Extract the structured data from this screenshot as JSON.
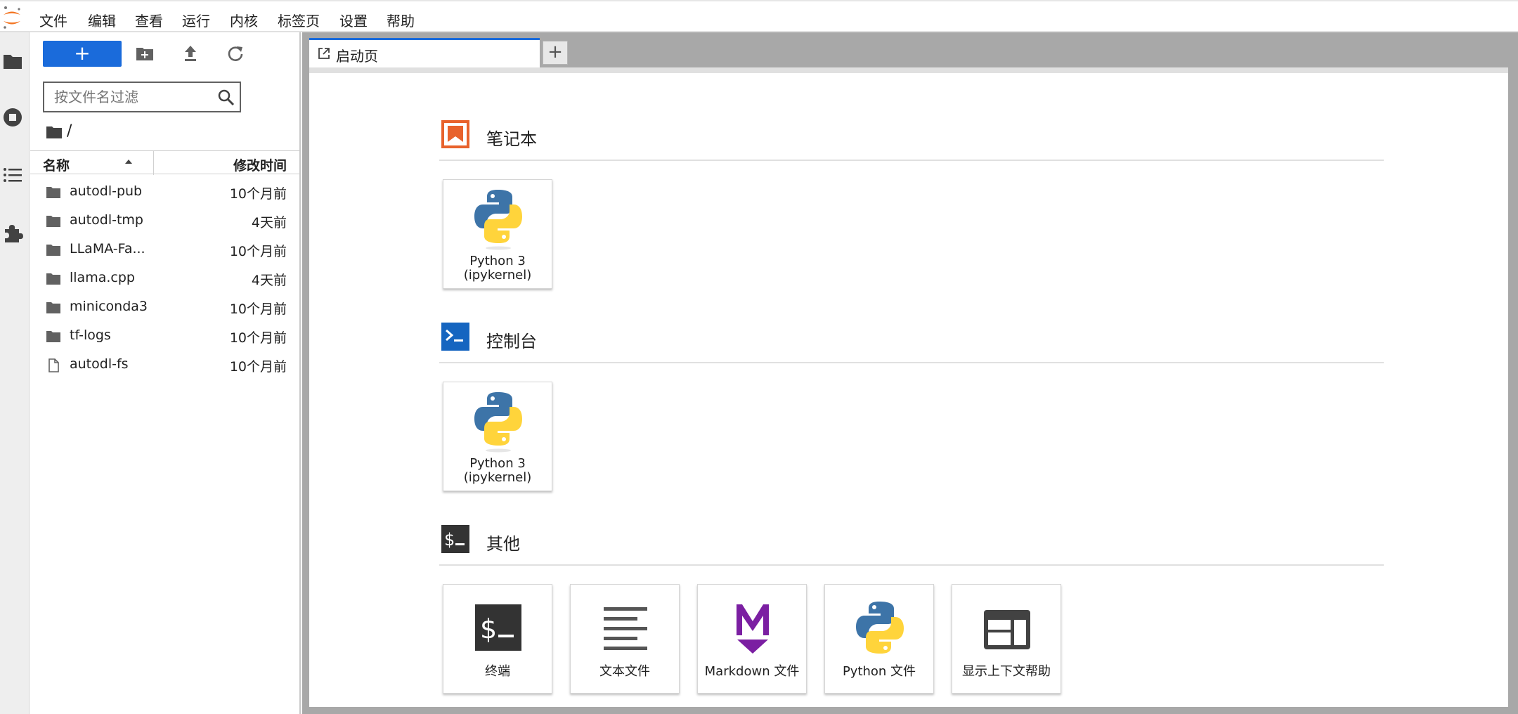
{
  "menu": {
    "items": [
      "文件",
      "编辑",
      "查看",
      "运行",
      "内核",
      "标签页",
      "设置",
      "帮助"
    ]
  },
  "filebrowser": {
    "new_button": "+",
    "filter_placeholder": "按文件名过滤",
    "breadcrumb": "/",
    "columns": {
      "name": "名称",
      "modified": "修改时间"
    },
    "files": [
      {
        "name": "autodl-pub",
        "modified": "10个月前",
        "type": "folder"
      },
      {
        "name": "autodl-tmp",
        "modified": "4天前",
        "type": "folder"
      },
      {
        "name": "LLaMA-Fa...",
        "modified": "10个月前",
        "type": "folder"
      },
      {
        "name": "llama.cpp",
        "modified": "4天前",
        "type": "folder"
      },
      {
        "name": "miniconda3",
        "modified": "10个月前",
        "type": "folder"
      },
      {
        "name": "tf-logs",
        "modified": "10个月前",
        "type": "folder"
      },
      {
        "name": "autodl-fs",
        "modified": "10个月前",
        "type": "file"
      }
    ]
  },
  "tabs": [
    {
      "label": "启动页",
      "icon": "launcher-icon"
    }
  ],
  "tab_add": "+",
  "launcher": {
    "sections": [
      {
        "title": "笔记本",
        "icon": "notebook-icon",
        "color": "#e8622c",
        "cards": [
          {
            "label_line1": "Python 3",
            "label_line2": "(ipykernel)",
            "icon": "python-icon"
          }
        ]
      },
      {
        "title": "控制台",
        "icon": "console-icon",
        "color": "#1565c0",
        "cards": [
          {
            "label_line1": "Python 3",
            "label_line2": "(ipykernel)",
            "icon": "python-icon"
          }
        ]
      },
      {
        "title": "其他",
        "icon": "terminal-section-icon",
        "color": "#333333",
        "cards": [
          {
            "label": "终端",
            "icon": "terminal-icon"
          },
          {
            "label": "文本文件",
            "icon": "text-file-icon"
          },
          {
            "label": "Markdown 文件",
            "icon": "markdown-icon"
          },
          {
            "label": "Python 文件",
            "icon": "python-file-icon"
          },
          {
            "label": "显示上下文帮助",
            "icon": "context-help-icon"
          }
        ]
      }
    ]
  },
  "colors": {
    "accent": "#1a6bdb",
    "markdown": "#7b1fa2",
    "python_blue": "#3d74a8",
    "python_yellow": "#ffd43b"
  }
}
